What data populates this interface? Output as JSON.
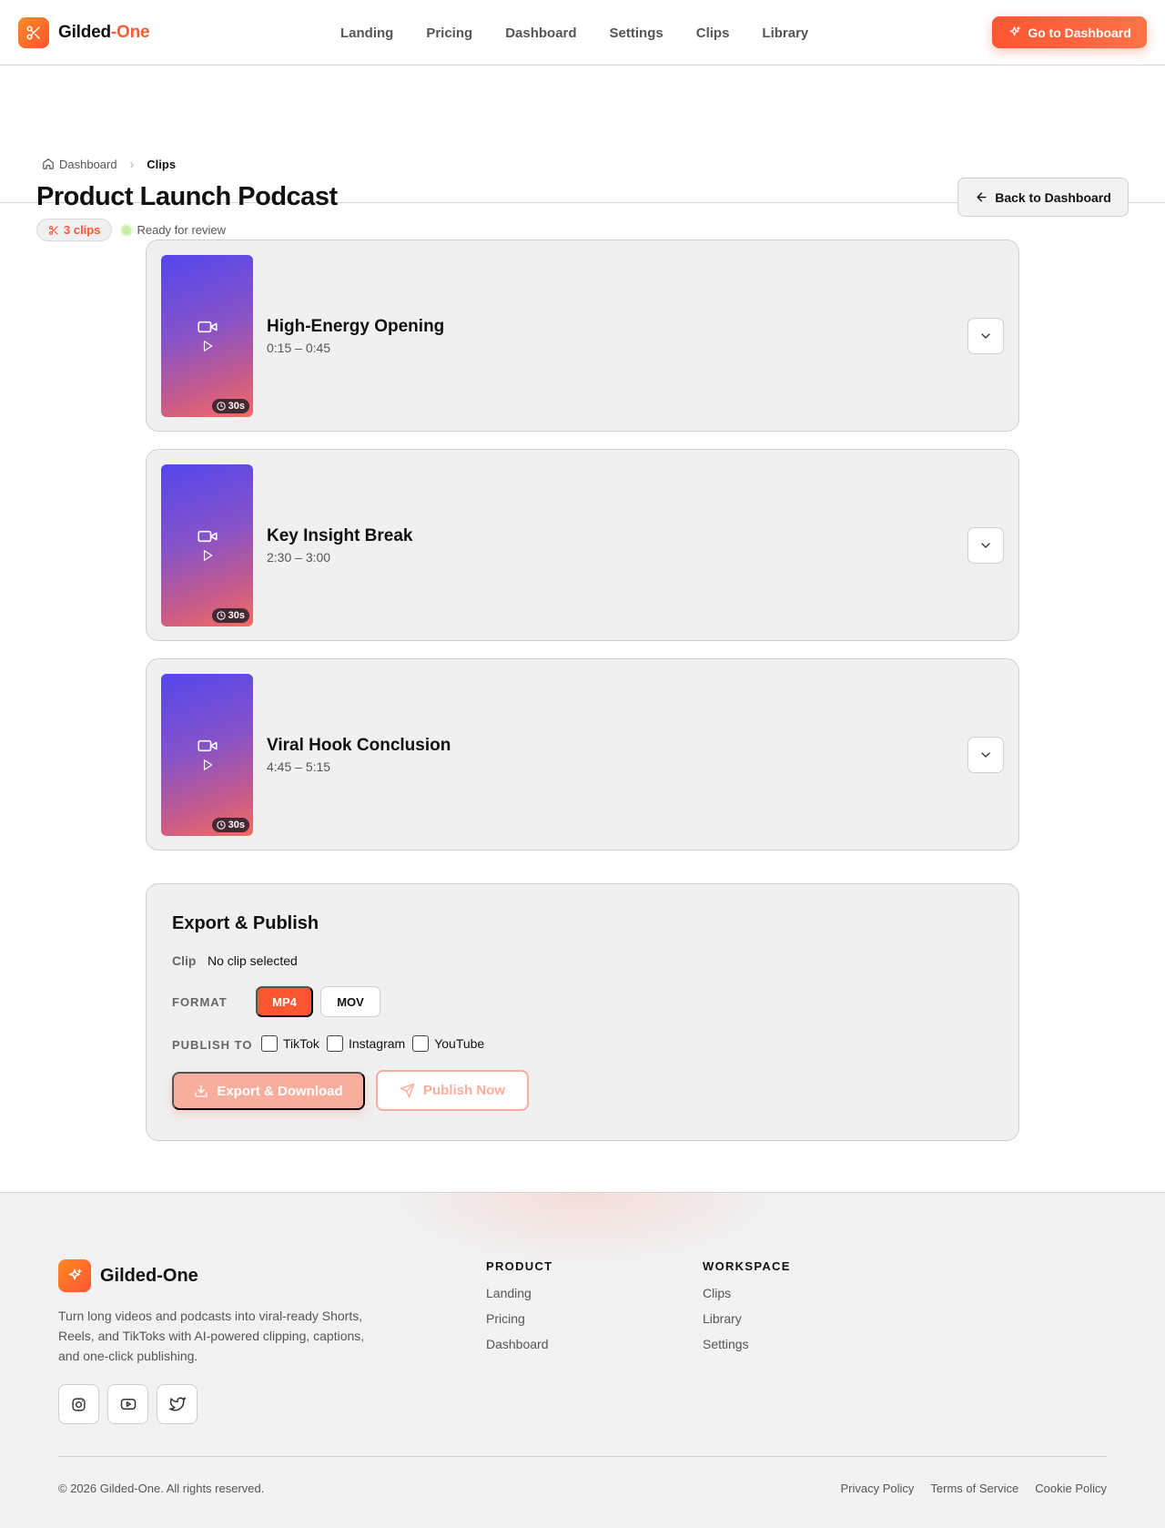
{
  "header": {
    "brand_primary": "Gilded",
    "brand_accent": "-One",
    "nav": [
      "Landing",
      "Pricing",
      "Dashboard",
      "Settings",
      "Clips",
      "Library"
    ],
    "cta_label": "Go to Dashboard"
  },
  "page": {
    "breadcrumb_home": "Dashboard",
    "breadcrumb_current": "Clips",
    "title": "Product Launch Podcast",
    "clip_count": "3 clips",
    "status": "Ready for review",
    "back_label": "Back to Dashboard"
  },
  "clips": [
    {
      "title": "High-Energy Opening",
      "range": "0:15 – 0:45",
      "duration": "30s"
    },
    {
      "title": "Key Insight Break",
      "range": "2:30 – 3:00",
      "duration": "30s"
    },
    {
      "title": "Viral Hook Conclusion",
      "range": "4:45 – 5:15",
      "duration": "30s"
    }
  ],
  "export": {
    "title": "Export & Publish",
    "clip_label": "Clip",
    "clip_value": "No clip selected",
    "format_label": "FORMAT",
    "formats": [
      "MP4",
      "MOV"
    ],
    "selected_format": "MP4",
    "publish_label": "PUBLISH TO",
    "platforms": [
      "TikTok",
      "Instagram",
      "YouTube"
    ],
    "export_label": "Export & Download",
    "publish_now_label": "Publish Now"
  },
  "footer": {
    "brand": "Gilded-One",
    "description": "Turn long videos and podcasts into viral-ready Shorts, Reels, and TikToks with AI-powered clipping, captions, and one-click publishing.",
    "product_title": "PRODUCT",
    "product_links": [
      "Landing",
      "Pricing",
      "Dashboard"
    ],
    "workspace_title": "WORKSPACE",
    "workspace_links": [
      "Clips",
      "Library",
      "Settings"
    ],
    "copyright": "© 2026 Gilded-One. All rights reserved.",
    "legal": [
      "Privacy Policy",
      "Terms of Service",
      "Cookie Policy"
    ]
  },
  "colors": {
    "accent": "#ff5533",
    "accent_muted": "#f9ad9c",
    "status_dot": "#c6f0a0"
  },
  "icons": {
    "brand": "scissors-icon",
    "cta": "sparkles-icon",
    "breadcrumb_home": "home-icon",
    "back": "arrow-left-icon",
    "thumb": [
      "video-icon",
      "play-icon"
    ],
    "duration": "clock-icon",
    "expand": "chevron-down-icon",
    "export": "download-icon",
    "publish": "send-icon",
    "socials": [
      "instagram-icon",
      "youtube-icon",
      "twitter-icon"
    ]
  }
}
